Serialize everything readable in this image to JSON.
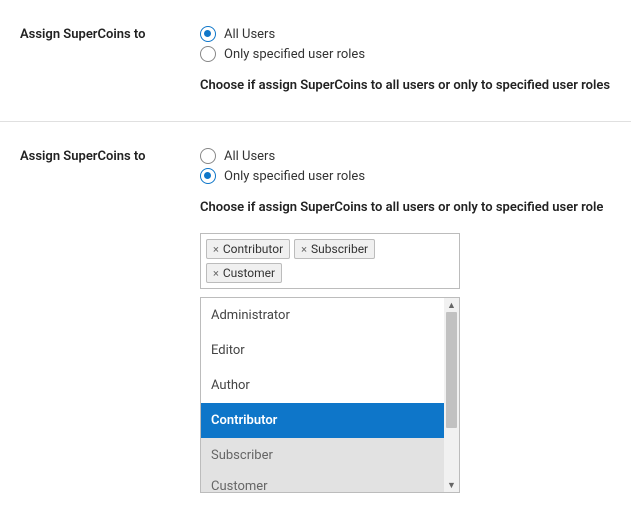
{
  "section1": {
    "label": "Assign SuperCoins to",
    "option_all": "All Users",
    "option_roles": "Only specified user roles",
    "help": "Choose if assign SuperCoins to all users or only to specified user roles"
  },
  "section2": {
    "label": "Assign SuperCoins to",
    "option_all": "All Users",
    "option_roles": "Only specified user roles",
    "help": "Choose if assign SuperCoins to all users or only to specified user role",
    "selected_tags": {
      "0": "Contributor",
      "1": "Subscriber",
      "2": "Customer"
    },
    "dropdown": {
      "0": "Administrator",
      "1": "Editor",
      "2": "Author",
      "3": "Contributor",
      "4": "Subscriber",
      "5": "Customer"
    }
  }
}
